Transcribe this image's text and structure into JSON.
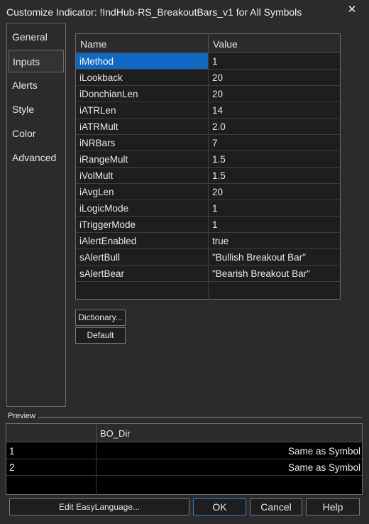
{
  "window": {
    "title": "Customize Indicator: !IndHub-RS_BreakoutBars_v1 for All Symbols",
    "close_glyph": "✕"
  },
  "nav": {
    "items": [
      {
        "label": "General",
        "active": false
      },
      {
        "label": "Inputs",
        "active": true
      },
      {
        "label": "Alerts",
        "active": false
      },
      {
        "label": "Style",
        "active": false
      },
      {
        "label": "Color",
        "active": false
      },
      {
        "label": "Advanced",
        "active": false
      }
    ]
  },
  "inputs": {
    "headers": {
      "name": "Name",
      "value": "Value"
    },
    "rows": [
      {
        "name": "iMethod",
        "value": "1"
      },
      {
        "name": "iLookback",
        "value": "20"
      },
      {
        "name": "iDonchianLen",
        "value": "20"
      },
      {
        "name": "iATRLen",
        "value": "14"
      },
      {
        "name": "iATRMult",
        "value": "2.0"
      },
      {
        "name": "iNRBars",
        "value": "7"
      },
      {
        "name": "iRangeMult",
        "value": "1.5"
      },
      {
        "name": "iVolMult",
        "value": "1.5"
      },
      {
        "name": "iAvgLen",
        "value": "20"
      },
      {
        "name": "iLogicMode",
        "value": "1"
      },
      {
        "name": "iTriggerMode",
        "value": "1"
      },
      {
        "name": "iAlertEnabled",
        "value": "true"
      },
      {
        "name": "sAlertBull",
        "value": "\"Bullish Breakout Bar\""
      },
      {
        "name": "sAlertBear",
        "value": "\"Bearish Breakout Bar\""
      }
    ],
    "selected_index": 0
  },
  "side_buttons": {
    "dictionary": "Dictionary...",
    "default": "Default"
  },
  "preview": {
    "label": "Preview",
    "headers": {
      "col1": "",
      "col2": "BO_Dir"
    },
    "rows": [
      {
        "index": "1",
        "value": "Same as Symbol"
      },
      {
        "index": "2",
        "value": "Same as Symbol"
      }
    ]
  },
  "footer": {
    "edit_easylanguage": "Edit EasyLanguage...",
    "ok": "OK",
    "cancel": "Cancel",
    "help": "Help"
  },
  "colors": {
    "selection": "#0e68c4",
    "background": "#2b2b2b",
    "grid_background": "#1e1e1e",
    "preview_background": "#000000",
    "ok_border": "#2a7fd4"
  }
}
